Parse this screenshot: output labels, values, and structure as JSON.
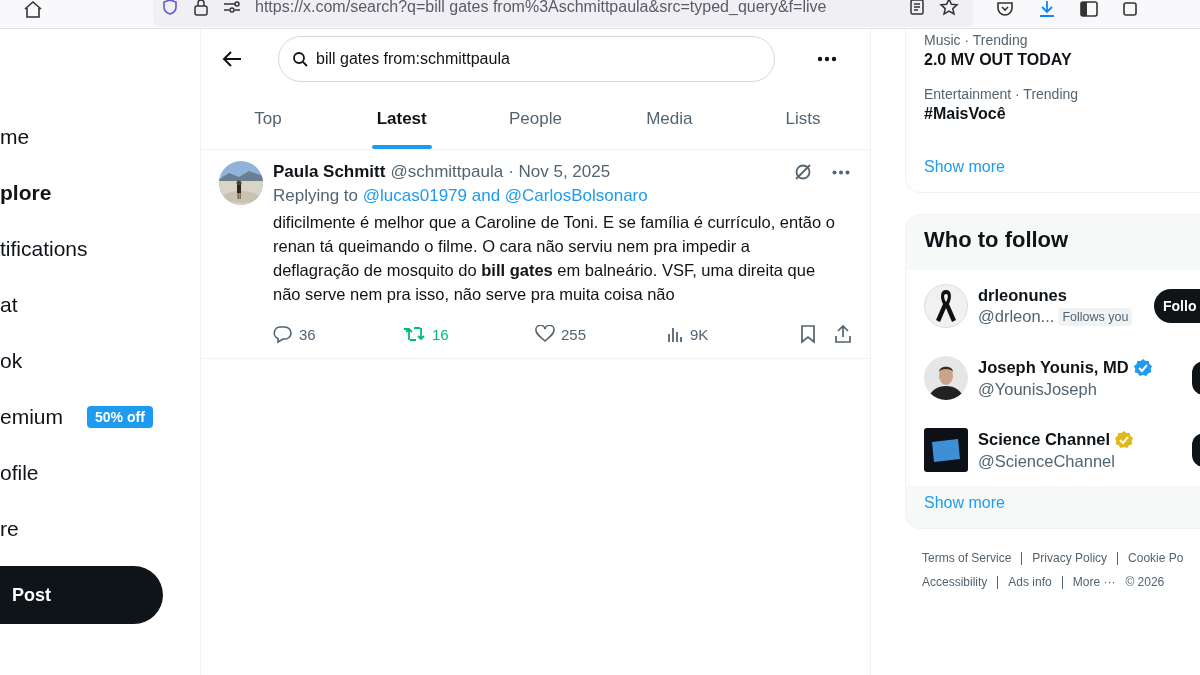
{
  "browser": {
    "url": "https://x.com/search?q=bill gates from%3Aschmittpaula&src=typed_query&f=live"
  },
  "nav": {
    "items": [
      {
        "label": "me",
        "selected": false
      },
      {
        "label": "plore",
        "selected": true
      },
      {
        "label": "tifications",
        "selected": false
      },
      {
        "label": "at",
        "selected": false
      },
      {
        "label": "ok",
        "selected": false
      },
      {
        "label": "emium",
        "selected": false,
        "badge": "50% off"
      },
      {
        "label": "ofile",
        "selected": false
      },
      {
        "label": "re",
        "selected": false
      }
    ],
    "post_button": "Post"
  },
  "search": {
    "value": "bill gates from:schmittpaula"
  },
  "tabs": [
    {
      "label": "Top",
      "selected": false
    },
    {
      "label": "Latest",
      "selected": true
    },
    {
      "label": "People",
      "selected": false
    },
    {
      "label": "Media",
      "selected": false
    },
    {
      "label": "Lists",
      "selected": false
    }
  ],
  "post": {
    "name": "Paula Schmitt",
    "handle": "@schmittpaula",
    "date": "· Nov 5, 2025",
    "replying_label": "Replying to",
    "replying_to": "@lucas01979 and @CarlosBolsonaro",
    "body": "dificilmente é melhor que a Caroline de Toni. E se família é currículo, então o renan tá queimando o filme. O cara não serviu nem pra impedir a deflagração de mosquito do **bill gates** em balneário. VSF, uma direita que não serve nem pra isso, não serve pra muita coisa não",
    "replies": "36",
    "reposts": "16",
    "reposted": true,
    "likes": "255",
    "liked": false,
    "views": "9K",
    "bookmarked": false
  },
  "trending": {
    "items": [
      {
        "context": "Music · Trending",
        "title": "2.0 MV OUT TODAY"
      },
      {
        "context": "Entertainment · Trending",
        "title": "#MaisVocê"
      }
    ],
    "show_more": "Show more"
  },
  "who_to_follow": {
    "title": "Who to follow",
    "accounts": [
      {
        "kind": "ribbon",
        "name": "drleonunes",
        "handle": "@drleon...",
        "follows_you": "Follows you",
        "follow_label": "Follo"
      },
      {
        "kind": "person",
        "name": "Joseph Younis, MD",
        "handle": "@YounisJoseph",
        "verified": true,
        "color": "#1d9bf0"
      },
      {
        "kind": "logo",
        "name": "Science Channel",
        "handle": "@ScienceChannel",
        "verified": true,
        "color": "#e2b719"
      }
    ],
    "show_more": "Show more"
  },
  "footer": {
    "links": [
      {
        "label": "Terms of Service",
        "separator": true
      },
      {
        "label": "Privacy Policy",
        "separator": true
      },
      {
        "label": "Cookie Po",
        "separator": false
      },
      {
        "label": "Accessibility",
        "separator": true
      },
      {
        "label": "Ads info",
        "separator": true
      },
      {
        "label": "More ···",
        "separator": false
      },
      {
        "label": "© 2026",
        "separator": false
      }
    ]
  }
}
